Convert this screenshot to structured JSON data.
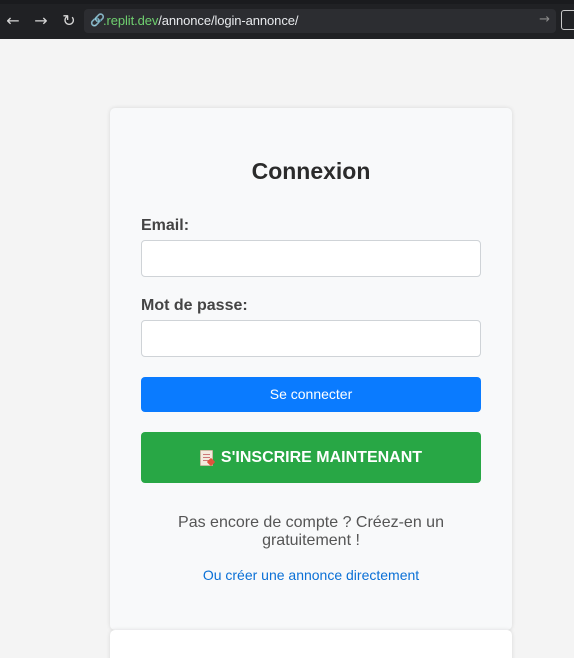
{
  "browser": {
    "url_domain": ".replit.dev",
    "url_path": "/annonce/login-annonce/",
    "icons": [
      "back-arrow-icon",
      "forward-arrow-icon",
      "reload-icon",
      "link-icon",
      "go-arrow-icon"
    ]
  },
  "login": {
    "title": "Connexion",
    "email_label": "Email:",
    "email_value": "",
    "password_label": "Mot de passe:",
    "password_value": "",
    "submit_label": "Se connecter",
    "signup_label": "S'INSCRIRE MAINTENANT",
    "signup_icon": "document-icon",
    "hint_text": "Pas encore de compte ? Créez-en un gratuitement !",
    "annonce_link": "Ou créer une annonce directement"
  },
  "colors": {
    "primary": "#0a7bff",
    "success": "#28a745",
    "link": "#0a70d6",
    "background": "#f4f4f4",
    "card": "#f8f9fa"
  }
}
